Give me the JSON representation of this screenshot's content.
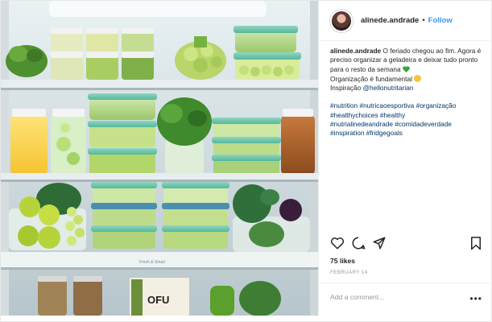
{
  "post": {
    "username": "alinede.andrade",
    "follow_label": "Follow",
    "separator": "•",
    "caption": {
      "username": "alinede.andrade",
      "line1": " O feriado chegou ao fim. Agora é preciso organizar a geladeira e deixar tudo pronto para o resto da semana ",
      "line2": "Organização é fundamental ",
      "line3_prefix": "Inspiração ",
      "mention": "@hellonutritarian",
      "hashtags": [
        "#nutrition",
        "#nutricaoesportiva",
        "#organização",
        "#healthychoices",
        "#healthy",
        "#nutrialinedeandrade",
        "#comidadeverdade",
        "#inspiration",
        "#fridgegoals"
      ]
    },
    "likes": "75 likes",
    "date": "FEBRUARY 14",
    "comment_placeholder": "Add a comment...",
    "more_label": "•••"
  },
  "photo": {
    "jar_label": "OFU",
    "drawer_label": "Fresh & Smart"
  },
  "colors": {
    "accent": "#3897f0",
    "hashtag": "#003569",
    "border": "#efefef"
  },
  "icons": [
    "heart-icon",
    "comment-icon",
    "share-icon",
    "bookmark-icon"
  ]
}
